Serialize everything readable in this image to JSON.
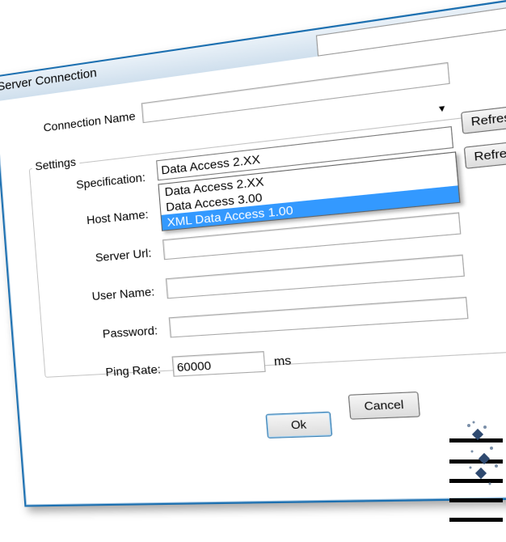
{
  "window": {
    "title": "Server Connection",
    "close_icon": "close-icon"
  },
  "form": {
    "connection_name_label": "Connection Name",
    "connection_name_value": "",
    "settings_label": "Settings",
    "specification_label": "Specification:",
    "specification_value": "Data Access 2.XX",
    "specification_options": [
      "Data Access 2.XX",
      "Data Access 3.00",
      "XML Data Access 1.00"
    ],
    "specification_highlighted": "XML Data Access 1.00",
    "host_name_label": "Host Name:",
    "server_url_label": "Server Url:",
    "user_name_label": "User Name:",
    "password_label": "Password:",
    "ping_rate_label": "Ping Rate:",
    "ping_rate_value": "60000",
    "ping_rate_unit": "ms"
  },
  "buttons": {
    "refresh_1": "Refresh",
    "refresh_2": "Refresh",
    "ok": "Ok",
    "cancel": "Cancel"
  },
  "colors": {
    "accent": "#3399ff",
    "border": "#1b6fb0"
  }
}
